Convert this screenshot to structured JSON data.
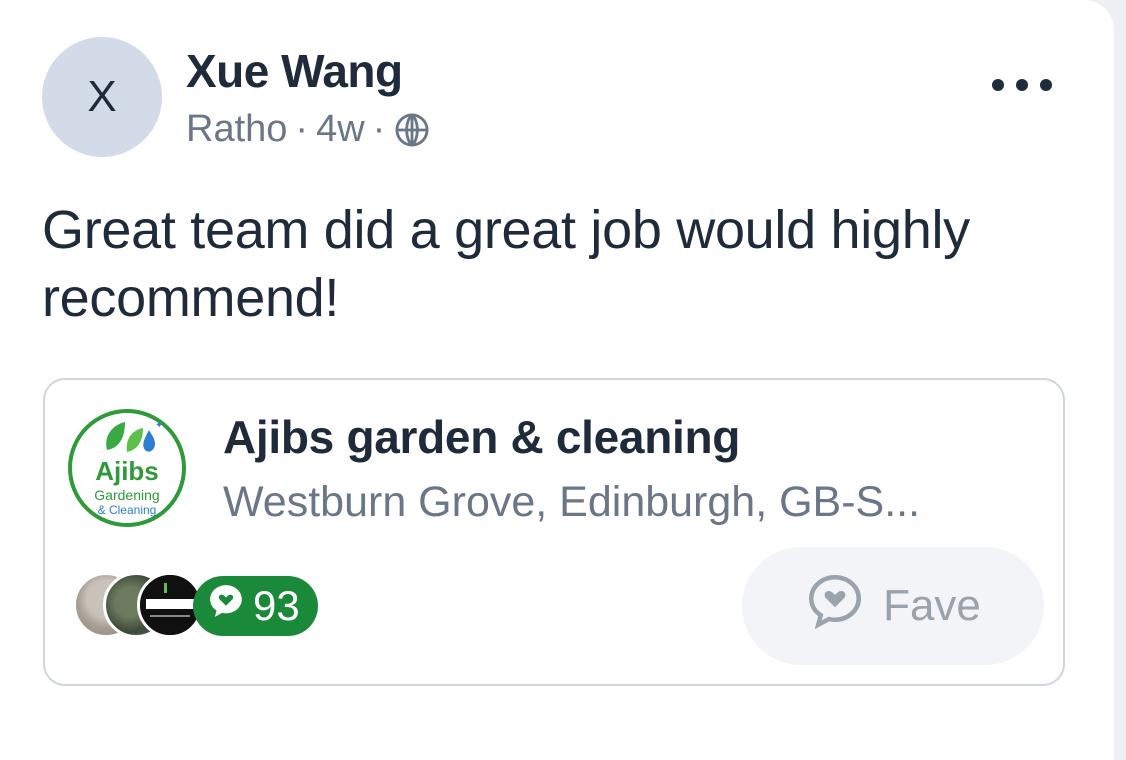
{
  "post": {
    "avatar_initial": "X",
    "author_name": "Xue Wang",
    "location": "Ratho",
    "separator": "·",
    "time_ago": "4w",
    "visibility_icon": "globe-icon",
    "more_icon": "more-options-icon",
    "text": "Great team did a great job would highly recommend!"
  },
  "business": {
    "logo_icon": "ajibs-logo",
    "name": "Ajibs garden & cleaning",
    "address": "Westburn Grove, Edinburgh,  GB-S...",
    "review_count": "93",
    "review_icon": "speech-bubble-heart-icon",
    "fave_label": "Fave",
    "fave_icon": "speech-bubble-heart-outline-icon"
  },
  "colors": {
    "primary_text": "#1f2a3a",
    "secondary_text": "#6b7687",
    "reviews_green": "#1a8a3a",
    "fave_bg": "#f3f4f7"
  }
}
